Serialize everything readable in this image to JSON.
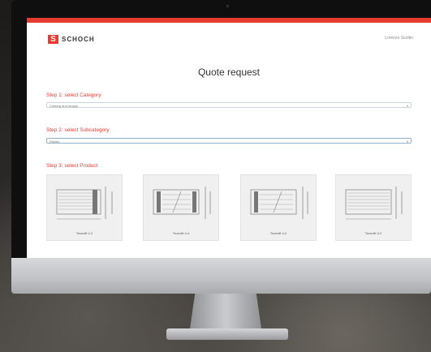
{
  "header": {
    "logo_mark": "S",
    "logo_text": "SCHOCH",
    "user_link": "Lorenzo Scottin"
  },
  "page": {
    "title": "Quote request"
  },
  "steps": {
    "step1_label": "Step 1: select Category",
    "step1_value": "Clicking and tongue",
    "step2_label": "Step 2: select Subcategory",
    "step2_value": "Panels",
    "step3_label": "Step 3: select Product"
  },
  "products": [
    {
      "label": "Tecnolit 2-2"
    },
    {
      "label": "Tecnolit 4-4"
    },
    {
      "label": "Tecnolit 4-2"
    },
    {
      "label": "Tecnolit 3-2"
    }
  ],
  "colors": {
    "accent": "#e63b2e",
    "select_border": "#c9d4dc"
  }
}
